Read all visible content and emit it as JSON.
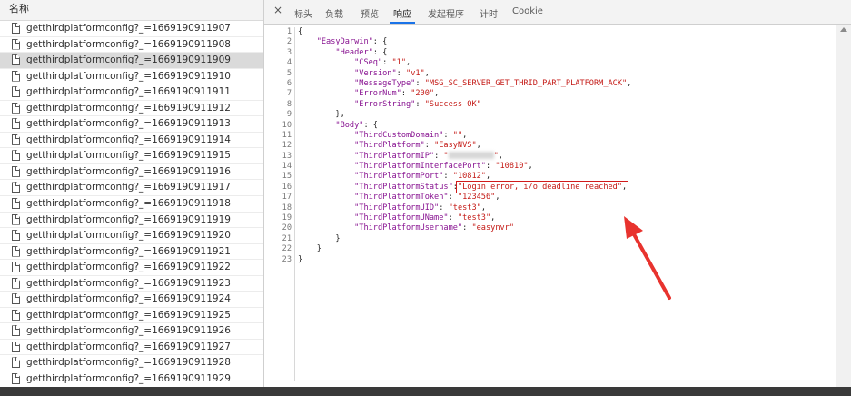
{
  "left_panel": {
    "header": "名称",
    "selected_index": 2,
    "requests": [
      "getthirdplatformconfig?_=1669190911907",
      "getthirdplatformconfig?_=1669190911908",
      "getthirdplatformconfig?_=1669190911909",
      "getthirdplatformconfig?_=1669190911910",
      "getthirdplatformconfig?_=1669190911911",
      "getthirdplatformconfig?_=1669190911912",
      "getthirdplatformconfig?_=1669190911913",
      "getthirdplatformconfig?_=1669190911914",
      "getthirdplatformconfig?_=1669190911915",
      "getthirdplatformconfig?_=1669190911916",
      "getthirdplatformconfig?_=1669190911917",
      "getthirdplatformconfig?_=1669190911918",
      "getthirdplatformconfig?_=1669190911919",
      "getthirdplatformconfig?_=1669190911920",
      "getthirdplatformconfig?_=1669190911921",
      "getthirdplatformconfig?_=1669190911922",
      "getthirdplatformconfig?_=1669190911923",
      "getthirdplatformconfig?_=1669190911924",
      "getthirdplatformconfig?_=1669190911925",
      "getthirdplatformconfig?_=1669190911926",
      "getthirdplatformconfig?_=1669190911927",
      "getthirdplatformconfig?_=1669190911928",
      "getthirdplatformconfig?_=1669190911929"
    ]
  },
  "tabs": {
    "close": "×",
    "headers": "标头",
    "payload": "负载",
    "preview": "预览",
    "response": "响应",
    "initiator": "发起程序",
    "timing": "计时",
    "cookie": "Cookie",
    "active": "response"
  },
  "code": {
    "line_numbers": [
      "1",
      "2",
      "3",
      "4",
      "5",
      "6",
      "7",
      "8",
      "9",
      "10",
      "11",
      "12",
      "13",
      "14",
      "15",
      "16",
      "17",
      "18",
      "19",
      "20",
      "21",
      "22",
      "23"
    ],
    "l1": "{",
    "l2_key": "\"EasyDarwin\"",
    "l2_rest": ": {",
    "l3_key": "\"Header\"",
    "l3_rest": ": {",
    "l4_key": "\"CSeq\"",
    "l4_val": "\"1\"",
    "l5_key": "\"Version\"",
    "l5_val": "\"v1\"",
    "l6_key": "\"MessageType\"",
    "l6_val": "\"MSG_SC_SERVER_GET_THRID_PART_PLATFORM_ACK\"",
    "l7_key": "\"ErrorNum\"",
    "l7_val": "\"200\"",
    "l8_key": "\"ErrorString\"",
    "l8_val": "\"Success OK\"",
    "l9": "},",
    "l10_key": "\"Body\"",
    "l10_rest": ": {",
    "l11_key": "\"ThirdCustomDomain\"",
    "l11_val": "\"\"",
    "l12_key": "\"ThirdPlatform\"",
    "l12_val": "\"EasyNVS\"",
    "l13_key": "\"ThirdPlatformIP\"",
    "l13_val_start": "\"",
    "l13_val_end": "\"",
    "l14_key": "\"ThirdPlatformInterfacePort\"",
    "l14_val": "\"10810\"",
    "l15_key": "\"ThirdPlatformPort\"",
    "l15_val": "\"10812\"",
    "l16_key": "\"ThirdPlatformStatus\"",
    "l16_val": "\"Login error, i/o deadline reached\"",
    "l17_key": "\"ThirdPlatformToken\"",
    "l17_val": "\"123456\"",
    "l18_key": "\"ThirdPlatformUID\"",
    "l18_val": "\"test3\"",
    "l19_key": "\"ThirdPlatformUName\"",
    "l19_val": "\"test3\"",
    "l20_key": "\"ThirdPlatformUsername\"",
    "l20_val": "\"easynvr\"",
    "l21": "}",
    "l22": "}",
    "l23": "}"
  },
  "colors": {
    "json_key": "#881391",
    "json_string": "#c41a16",
    "highlight_box": "#d11a1a",
    "arrow": "#e8332e",
    "tab_active_underline": "#1a73e8"
  }
}
